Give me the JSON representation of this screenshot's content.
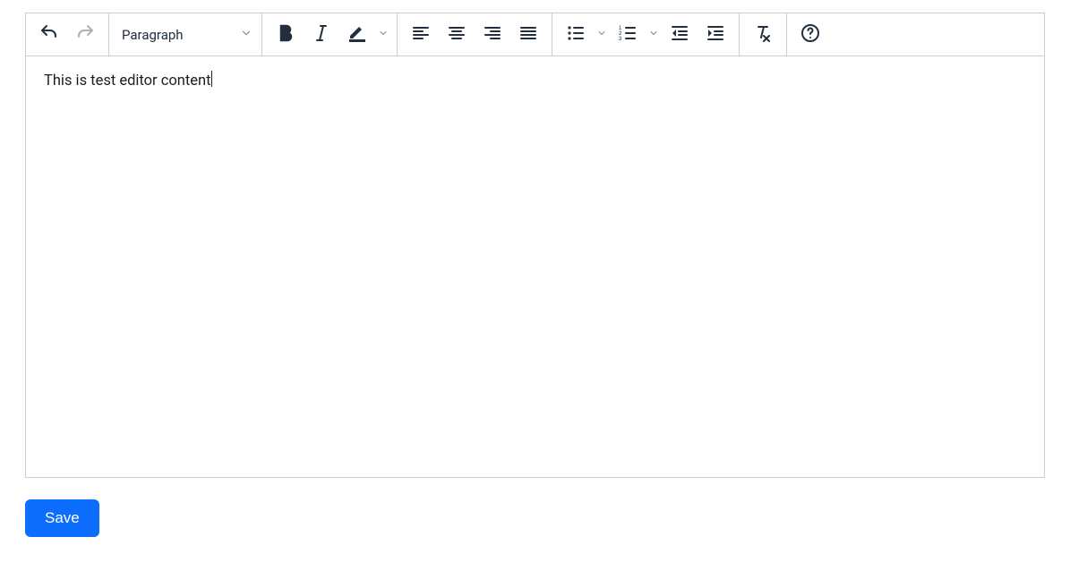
{
  "toolbar": {
    "format_selector": "Paragraph",
    "icons": {
      "undo": "undo-icon",
      "redo": "redo-icon",
      "bold": "bold-icon",
      "italic": "italic-icon",
      "forecolor": "text-color-icon",
      "alignleft": "align-left-icon",
      "aligncenter": "align-center-icon",
      "alignright": "align-right-icon",
      "alignjustify": "align-justify-icon",
      "bullist": "bullet-list-icon",
      "numlist": "numbered-list-icon",
      "outdent": "outdent-icon",
      "indent": "indent-icon",
      "removefmt": "clear-format-icon",
      "help": "help-icon"
    },
    "forecolor_swatch": "#222f3e"
  },
  "editor": {
    "content": "This is test editor content"
  },
  "buttons": {
    "save": "Save"
  }
}
